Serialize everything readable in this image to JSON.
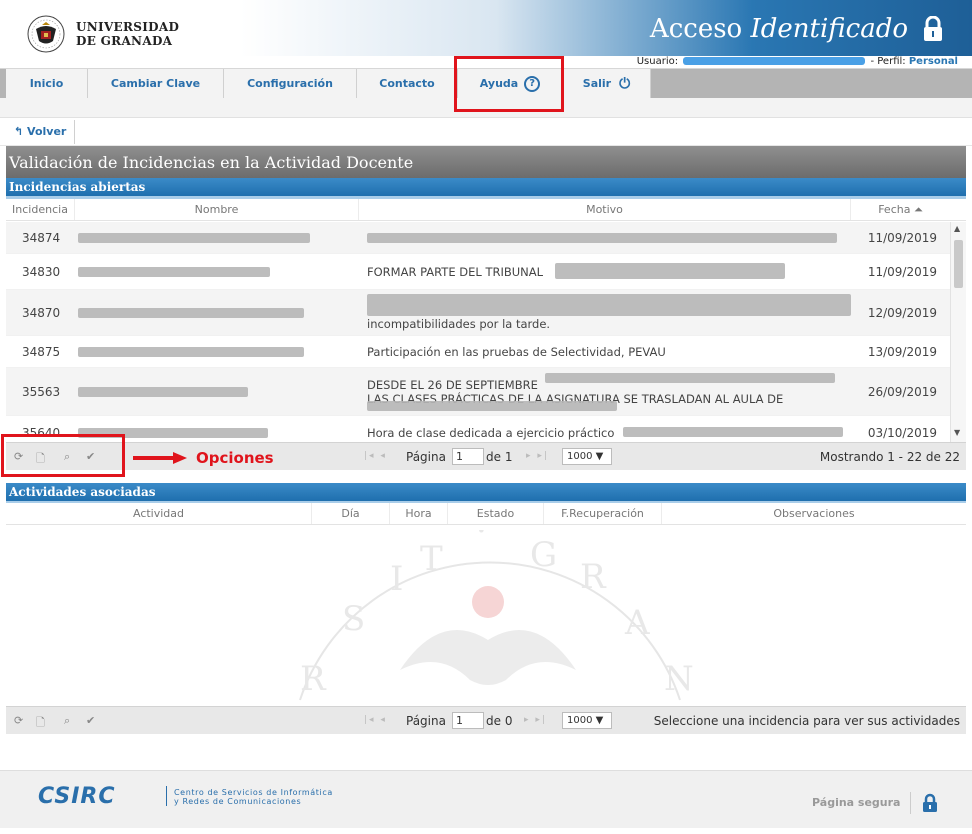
{
  "header": {
    "university_line1": "UNIVERSIDAD",
    "university_line2": "DE GRANADA",
    "app_title_plain": "Acceso",
    "app_title_italic": "Identificado",
    "user_label": "Usuario:",
    "profile_label": "- Perfil:",
    "profile_value": "Personal"
  },
  "nav": {
    "items": [
      {
        "label": "Inicio"
      },
      {
        "label": "Cambiar Clave"
      },
      {
        "label": "Configuración"
      },
      {
        "label": "Contacto"
      },
      {
        "label": "Ayuda"
      },
      {
        "label": "Salir"
      }
    ]
  },
  "back": {
    "label": "Volver"
  },
  "page_title": "Validación de Incidencias en la Actividad Docente",
  "incidencias": {
    "section_title": "Incidencias abiertas",
    "columns": [
      "Incidencia",
      "Nombre",
      "Motivo",
      "Fecha"
    ],
    "rows": [
      {
        "id": "34874",
        "motivo": "",
        "fecha": "11/09/2019"
      },
      {
        "id": "34830",
        "motivo": "FORMAR PARTE DEL TRIBUNAL",
        "fecha": "11/09/2019"
      },
      {
        "id": "34870",
        "motivo": "incompatibilidades por la tarde.",
        "fecha": "12/09/2019"
      },
      {
        "id": "34875",
        "motivo": "Participación en las pruebas de Selectividad, PEVAU",
        "fecha": "13/09/2019"
      },
      {
        "id": "35563",
        "motivo": "DESDE EL 26 DE SEPTIEMBRE",
        "motivo2": "LAS CLASES PRÁCTICAS DE LA ASIGNATURA SE TRASLADAN AL AULA DE",
        "fecha": "26/09/2019"
      },
      {
        "id": "35640",
        "motivo": "Hora de clase dedicada a ejercicio práctico",
        "fecha": "03/10/2019"
      }
    ],
    "pager": {
      "page_label": "Página",
      "page_value": "1",
      "of_label": "de 1",
      "rows_per_page": "1000",
      "info": "Mostrando 1 - 22 de 22"
    }
  },
  "annotation": {
    "options_label": "Opciones"
  },
  "actividades": {
    "section_title": "Actividades asociadas",
    "columns": [
      "Actividad",
      "Día",
      "Hora",
      "Estado",
      "F.Recuperación",
      "Observaciones"
    ],
    "pager": {
      "page_label": "Página",
      "page_value": "1",
      "of_label": "de 0",
      "rows_per_page": "1000",
      "info": "Seleccione una incidencia para ver sus actividades"
    }
  },
  "footer": {
    "brand": "CSIRC",
    "tagline1": "Centro de Servicios de Informática",
    "tagline2": "y Redes de Comunicaciones",
    "secure": "Página segura"
  },
  "colors": {
    "brand_blue": "#2a6fab",
    "highlight_red": "#e0141c"
  }
}
